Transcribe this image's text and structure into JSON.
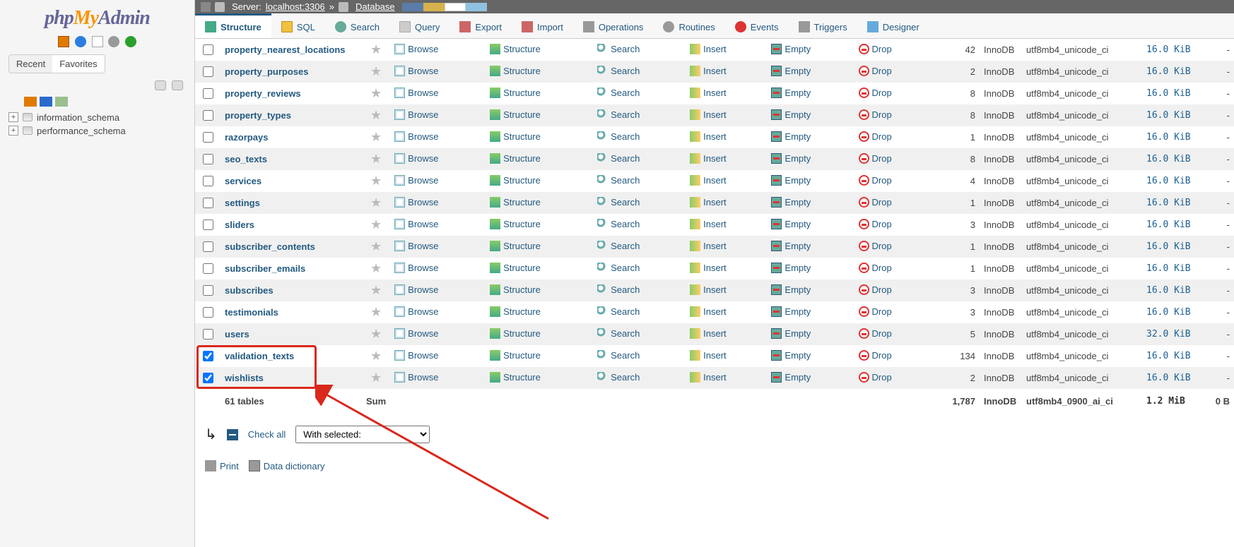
{
  "logo": {
    "p1": "php",
    "p2": "My",
    "p3": "Admin"
  },
  "panel_tabs": {
    "recent": "Recent",
    "favorites": "Favorites"
  },
  "tree_swatches": true,
  "tree": [
    {
      "label": "information_schema"
    },
    {
      "label": "performance_schema"
    }
  ],
  "breadcrumb": {
    "server_label": "Server:",
    "server": "localhost:3306",
    "sep": "»",
    "db_label": "Database"
  },
  "tabs": [
    {
      "name": "structure",
      "label": "Structure",
      "icon": "ti-struct",
      "active": true
    },
    {
      "name": "sql",
      "label": "SQL",
      "icon": "ti-sql"
    },
    {
      "name": "search",
      "label": "Search",
      "icon": "ti-search"
    },
    {
      "name": "query",
      "label": "Query",
      "icon": "ti-query"
    },
    {
      "name": "export",
      "label": "Export",
      "icon": "ti-export"
    },
    {
      "name": "import",
      "label": "Import",
      "icon": "ti-import"
    },
    {
      "name": "operations",
      "label": "Operations",
      "icon": "ti-ops"
    },
    {
      "name": "routines",
      "label": "Routines",
      "icon": "ti-rout"
    },
    {
      "name": "events",
      "label": "Events",
      "icon": "ti-events"
    },
    {
      "name": "triggers",
      "label": "Triggers",
      "icon": "ti-trig"
    },
    {
      "name": "designer",
      "label": "Designer",
      "icon": "ti-design"
    }
  ],
  "actions": {
    "browse": "Browse",
    "structure": "Structure",
    "search": "Search",
    "insert": "Insert",
    "empty": "Empty",
    "drop": "Drop"
  },
  "tables": [
    {
      "name": "property_nearest_locations",
      "rows": "42",
      "engine": "InnoDB",
      "collation": "utf8mb4_unicode_ci",
      "size": "16.0 KiB",
      "overhead": "-",
      "checked": false
    },
    {
      "name": "property_purposes",
      "rows": "2",
      "engine": "InnoDB",
      "collation": "utf8mb4_unicode_ci",
      "size": "16.0 KiB",
      "overhead": "-",
      "checked": false
    },
    {
      "name": "property_reviews",
      "rows": "8",
      "engine": "InnoDB",
      "collation": "utf8mb4_unicode_ci",
      "size": "16.0 KiB",
      "overhead": "-",
      "checked": false
    },
    {
      "name": "property_types",
      "rows": "8",
      "engine": "InnoDB",
      "collation": "utf8mb4_unicode_ci",
      "size": "16.0 KiB",
      "overhead": "-",
      "checked": false
    },
    {
      "name": "razorpays",
      "rows": "1",
      "engine": "InnoDB",
      "collation": "utf8mb4_unicode_ci",
      "size": "16.0 KiB",
      "overhead": "-",
      "checked": false
    },
    {
      "name": "seo_texts",
      "rows": "8",
      "engine": "InnoDB",
      "collation": "utf8mb4_unicode_ci",
      "size": "16.0 KiB",
      "overhead": "-",
      "checked": false
    },
    {
      "name": "services",
      "rows": "4",
      "engine": "InnoDB",
      "collation": "utf8mb4_unicode_ci",
      "size": "16.0 KiB",
      "overhead": "-",
      "checked": false
    },
    {
      "name": "settings",
      "rows": "1",
      "engine": "InnoDB",
      "collation": "utf8mb4_unicode_ci",
      "size": "16.0 KiB",
      "overhead": "-",
      "checked": false
    },
    {
      "name": "sliders",
      "rows": "3",
      "engine": "InnoDB",
      "collation": "utf8mb4_unicode_ci",
      "size": "16.0 KiB",
      "overhead": "-",
      "checked": false
    },
    {
      "name": "subscriber_contents",
      "rows": "1",
      "engine": "InnoDB",
      "collation": "utf8mb4_unicode_ci",
      "size": "16.0 KiB",
      "overhead": "-",
      "checked": false
    },
    {
      "name": "subscriber_emails",
      "rows": "1",
      "engine": "InnoDB",
      "collation": "utf8mb4_unicode_ci",
      "size": "16.0 KiB",
      "overhead": "-",
      "checked": false
    },
    {
      "name": "subscribes",
      "rows": "3",
      "engine": "InnoDB",
      "collation": "utf8mb4_unicode_ci",
      "size": "16.0 KiB",
      "overhead": "-",
      "checked": false
    },
    {
      "name": "testimonials",
      "rows": "3",
      "engine": "InnoDB",
      "collation": "utf8mb4_unicode_ci",
      "size": "16.0 KiB",
      "overhead": "-",
      "checked": false
    },
    {
      "name": "users",
      "rows": "5",
      "engine": "InnoDB",
      "collation": "utf8mb4_unicode_ci",
      "size": "32.0 KiB",
      "overhead": "-",
      "checked": false
    },
    {
      "name": "validation_texts",
      "rows": "134",
      "engine": "InnoDB",
      "collation": "utf8mb4_unicode_ci",
      "size": "16.0 KiB",
      "overhead": "-",
      "checked": true
    },
    {
      "name": "wishlists",
      "rows": "2",
      "engine": "InnoDB",
      "collation": "utf8mb4_unicode_ci",
      "size": "16.0 KiB",
      "overhead": "-",
      "checked": true
    }
  ],
  "summary": {
    "count": "61 tables",
    "label": "Sum",
    "rows": "1,787",
    "engine": "InnoDB",
    "collation": "utf8mb4_0900_ai_ci",
    "size": "1.2 MiB",
    "overhead": "0 B"
  },
  "footer": {
    "check_all": "Check all",
    "with_selected": "With selected:",
    "print": "Print",
    "data_dictionary": "Data dictionary"
  }
}
